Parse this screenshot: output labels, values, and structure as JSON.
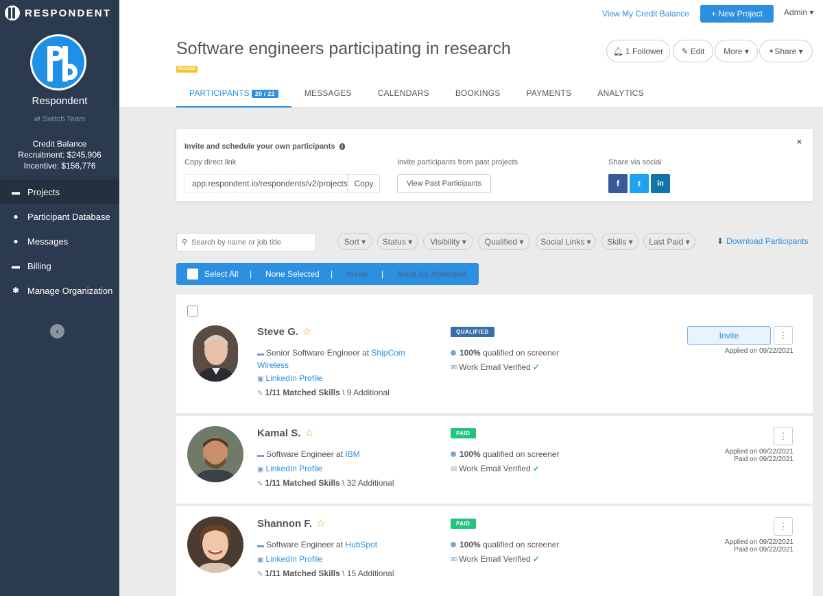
{
  "brand": {
    "name": "RESPONDENT"
  },
  "sidebar": {
    "team_name": "Respondent",
    "switch_team": "⇄ Switch Team",
    "credit_title": "Credit Balance",
    "recruitment": "Recruitment: $245,906",
    "incentive": "Incentive: $156,776",
    "items": [
      {
        "label": "Projects",
        "icon": "folder-icon"
      },
      {
        "label": "Participant Database",
        "icon": "users-icon"
      },
      {
        "label": "Messages",
        "icon": "comments-icon"
      },
      {
        "label": "Billing",
        "icon": "credit-card-icon"
      },
      {
        "label": "Manage Organization",
        "icon": "gear-icon"
      }
    ]
  },
  "header": {
    "credit_link": "View My Credit Balance",
    "new_project": "+ New Project",
    "admin": "Admin ▾",
    "project_title": "Software engineers participating in research",
    "status": "PAUSED",
    "follower": "1 Follower",
    "edit": "Edit",
    "more": "More ▾",
    "share": "Share ▾"
  },
  "tabs": [
    {
      "label": "PARTICIPANTS",
      "count": "20 / 22"
    },
    {
      "label": "MESSAGES"
    },
    {
      "label": "CALENDARS"
    },
    {
      "label": "BOOKINGS"
    },
    {
      "label": "PAYMENTS"
    },
    {
      "label": "ANALYTICS"
    }
  ],
  "invite_panel": {
    "title": "Invite and schedule your own participants",
    "copy_label": "Copy direct link",
    "link": "app.respondent.io/respondents/v2/projects",
    "copy_button": "Copy",
    "past_label": "Invite participants from past projects",
    "past_button": "View Past Participants",
    "social_label": "Share via social",
    "close": "×"
  },
  "toolbar": {
    "search_placeholder": "Search by name or job title",
    "filters": [
      "Sort ▾",
      "Status ▾",
      "Visibility ▾",
      "Qualified ▾",
      "Social Links ▾",
      "Skills ▾",
      "Last Paid ▾"
    ],
    "download": "Download Participants"
  },
  "bulk": {
    "select_all": "Select All",
    "none_selected": "None Selected",
    "invite": "Invite",
    "mark_attended": "Mark As Attended",
    "sep": "|"
  },
  "participants": [
    {
      "name": "Steve G.",
      "title_prefix": "Senior Software Engineer at ",
      "company": "ShipCom Wireless",
      "linkedin": "LinkedIn Profile",
      "skills_bold": "1/11 Matched Skills",
      "skills_rest": " \\ 9 Additional",
      "status": "QUALIFIED",
      "status_color": "#3a6ea8",
      "qualified_bold": "100%",
      "qualified_rest": " qualified on screener",
      "email": "Work Email Verified",
      "invite": "Invite",
      "applied": "Applied on 09/22/2021",
      "paid": ""
    },
    {
      "name": "Kamal S.",
      "title_prefix": "Software Engineer at ",
      "company": "IBM",
      "linkedin": "LinkedIn Profile",
      "skills_bold": "1/11 Matched Skills",
      "skills_rest": " \\ 32 Additional",
      "status": "PAID",
      "status_color": "#26c281",
      "qualified_bold": "100%",
      "qualified_rest": " qualified on screener",
      "email": "Work Email Verified",
      "applied": "Applied on 09/22/2021",
      "paid": "Paid on 09/22/2021"
    },
    {
      "name": "Shannon F.",
      "title_prefix": "Software Engineer at ",
      "company": "HubSpot",
      "linkedin": "LinkedIn Profile",
      "skills_bold": "1/11 Matched Skills",
      "skills_rest": " \\ 15 Additional",
      "status": "PAID",
      "status_color": "#26c281",
      "qualified_bold": "100%",
      "qualified_rest": " qualified on screener",
      "email": "Work Email Verified",
      "applied": "Applied on 09/22/2021",
      "paid": "Paid on 09/22/2021"
    }
  ]
}
